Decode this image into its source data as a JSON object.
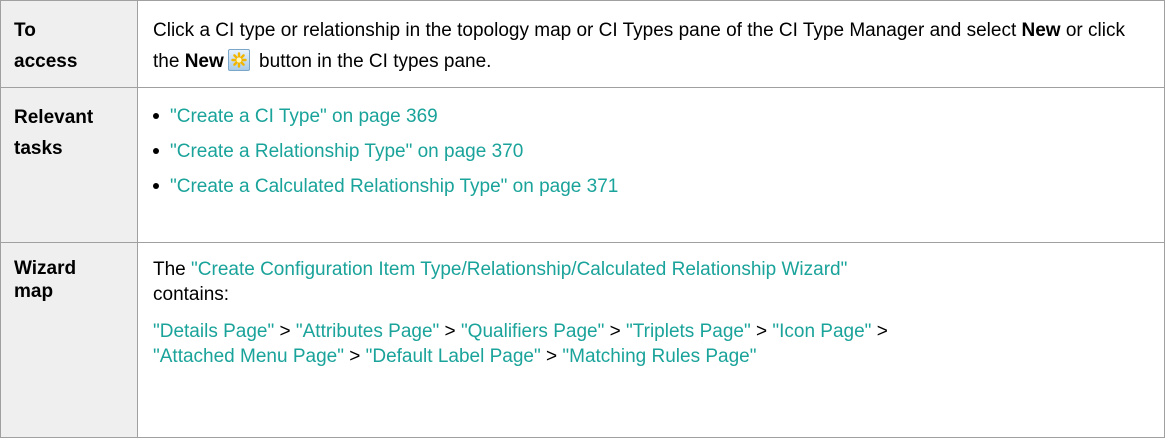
{
  "rows": {
    "access": {
      "label_line1": "To",
      "label_line2": "access",
      "text1": "Click a CI type or relationship in the topology map or CI Types pane of the CI Type Manager and select ",
      "new1": "New",
      "text2": " or click the ",
      "new2": "New",
      "text3": " button in the CI types pane.",
      "icon": "new-star-icon"
    },
    "tasks": {
      "label_line1": "Relevant",
      "label_line2": "tasks",
      "items": [
        "\"Create a CI Type\" on page 369",
        "\"Create a Relationship Type\" on page 370",
        "\"Create a Calculated Relationship Type\" on page 371"
      ]
    },
    "wizard": {
      "label_line1": "Wizard",
      "label_line2": "map",
      "intro_prefix": "The ",
      "intro_link": "\"Create Configuration Item Type/Relationship/Calculated Relationship Wizard\"",
      "intro_suffix": " contains:",
      "pages": [
        "\"Details Page\"",
        "\"Attributes Page\"",
        "\"Qualifiers Page\"",
        "\"Triplets Page\"",
        "\"Icon Page\"",
        "\"Attached Menu Page\"",
        "\"Default Label Page\"",
        "\"Matching Rules Page\""
      ],
      "separator": " > "
    }
  },
  "colors": {
    "link": "#1aa39a",
    "label_bg": "#efefef",
    "border": "#a0a0a0"
  }
}
